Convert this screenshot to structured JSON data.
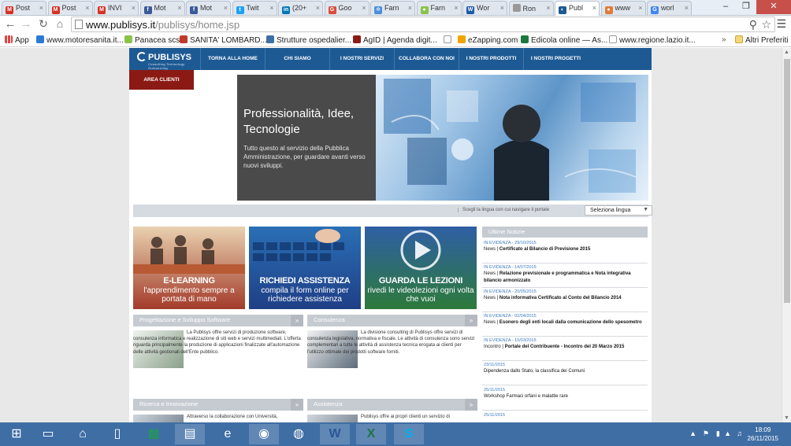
{
  "browser": {
    "tabs": [
      {
        "label": "Post",
        "color": "#d93025",
        "glyph": "M"
      },
      {
        "label": "Post",
        "color": "#d93025",
        "glyph": "M"
      },
      {
        "label": "INVI",
        "color": "#d93025",
        "glyph": "M"
      },
      {
        "label": "Mot",
        "color": "#3b5998",
        "glyph": "f"
      },
      {
        "label": "Mot",
        "color": "#3b5998",
        "glyph": "f"
      },
      {
        "label": "Twit",
        "color": "#1da1f2",
        "glyph": "t"
      },
      {
        "label": "(20+",
        "color": "#0077b5",
        "glyph": "in"
      },
      {
        "label": "Goo",
        "color": "#dd4b39",
        "glyph": "G"
      },
      {
        "label": "Farn",
        "color": "#4a90d9",
        "glyph": "✲"
      },
      {
        "label": "Farn",
        "color": "#8bc34a",
        "glyph": "●"
      },
      {
        "label": "Wor",
        "color": "#1e5aa8",
        "glyph": "W"
      },
      {
        "label": "Ron",
        "color": "#999999",
        "glyph": ""
      },
      {
        "label": "Publ",
        "color": "#1d5a93",
        "glyph": "◐"
      },
      {
        "label": "www",
        "color": "#e07b39",
        "glyph": "●"
      },
      {
        "label": "worl",
        "color": "#4285f4",
        "glyph": "G"
      }
    ],
    "active_tab": 12,
    "url_domain": "www.publisys.it",
    "url_path": "/publisys/home.jsp"
  },
  "bookmarks": {
    "apps_label": "App",
    "items": [
      {
        "label": "www.motoresanita.it...",
        "color": "#2b7bd6"
      },
      {
        "label": "Panacea scs",
        "color": "#8bc34a"
      },
      {
        "label": "SANITA' LOMBARD...",
        "color": "#c0392b"
      },
      {
        "label": "Strutture ospedalier...",
        "color": "#3f6ea5"
      },
      {
        "label": "AgID | Agenda digit...",
        "color": "#8b1a14"
      },
      {
        "label": "",
        "color": "#ffffff"
      },
      {
        "label": "eZapping.com",
        "color": "#f0a500"
      },
      {
        "label": "Edicola online — As...",
        "color": "#1a7a3a"
      },
      {
        "label": "www.regione.lazio.it...",
        "color": "#ffffff"
      }
    ],
    "overflow": "»",
    "other": "Altri Preferiti"
  },
  "site": {
    "logo": "PUBLISYS",
    "logo_sub": "Consulting  Technology  Outsourcing",
    "nav": [
      "TORNA ALLA HOME",
      "CHI SIAMO",
      "I NOSTRI SERVIZI",
      "COLLABORA CON NOI",
      "I NOSTRI PRODOTTI",
      "I NOSTRI PROGETTI"
    ],
    "area_clienti": "AREA CLIENTI",
    "hero_title": "Professionalità, Idee, Tecnologie",
    "hero_sub": "Tutto questo al servizio della Pubblica Amministrazione, per guardare avanti verso nuovi sviluppi.",
    "lang_prompt": "Scegli la lingua con cui navigare il portale",
    "lang_select": "Seleziona lingua",
    "promos": [
      {
        "t1": "E-LEARNING",
        "t2": "l'apprendimento sempre a portata di mano",
        "bg": "#a33b2a"
      },
      {
        "t1": "RICHIEDI ASSISTENZA",
        "t2": "compila il form online per richiedere assistenza",
        "bg": "#1f3f86"
      },
      {
        "t1": "GUARDA LE LEZIONI",
        "t2": "rivedi le videolezioni ogni volta che vuoi",
        "bg": "#2d7a3a"
      }
    ],
    "news_head": "Ultime Notizie",
    "news": [
      {
        "tag": "IN EVIDENZA - 29/10/2015",
        "cat": "News",
        "title": "Certificato al Bilancio di Previsione 2015"
      },
      {
        "tag": "IN EVIDENZA - 14/07/2015",
        "cat": "News",
        "title": "Relazione previsionale e programmatica e Nota integrativa bilancio armonizzato"
      },
      {
        "tag": "IN EVIDENZA - 20/05/2015",
        "cat": "News",
        "title": "Nota informativa Certificato al Conto del Bilancio 2014"
      },
      {
        "tag": "IN EVIDENZA - 02/04/2015",
        "cat": "News",
        "title": "Esonero degli enti locali dalla comunicazione dello spesometro"
      },
      {
        "tag": "IN EVIDENZA - 10/03/2015",
        "cat": "Incontro",
        "title": "Portale del Contribuente - Incontro del 20 Marzo 2015"
      },
      {
        "tag": "23/11/2015",
        "cat": "",
        "title": "Dipendenza dallo Stato, la classifica dei Comuni"
      },
      {
        "tag": "25/11/2015",
        "cat": "",
        "title": "Workshop Farmaci orfani e malattie rare"
      },
      {
        "tag": "25/11/2015",
        "cat": "",
        "title": ""
      }
    ],
    "sections": [
      {
        "head": "Progettazione e Sviluppo Software",
        "text": "La Publisys offre servizi di produzione software, consulenza informatica e realizzazione di siti web e servizi multimediali. L'offerta riguarda principalmente la produzione di applicazioni finalizzate all'automazione delle attività gestionali dell'Ente pubblico."
      },
      {
        "head": "Consulenza",
        "text": "La divisione consulting di Publisys offre servizi di consulenza legislativa, normativa e fiscale. Le attività di consulenza sono servizi complementari a tutte le attività di assistenza tecnica erogata ai clienti per l'utilizzo ottimale dei prodotti software forniti."
      },
      {
        "head": "Ricerca e Innovazione",
        "text": "Attraverso la collaborazione con Università,"
      },
      {
        "head": "Assistenza",
        "text": "Publisys offre ai propri clienti un servizio di"
      }
    ]
  },
  "taskbar": {
    "apps": [
      "start",
      "desktop",
      "home",
      "file",
      "store",
      "explorer",
      "ie",
      "chrome",
      "firefox",
      "word",
      "excel",
      "skype"
    ],
    "time": "18:09",
    "date": "26/11/2015"
  }
}
